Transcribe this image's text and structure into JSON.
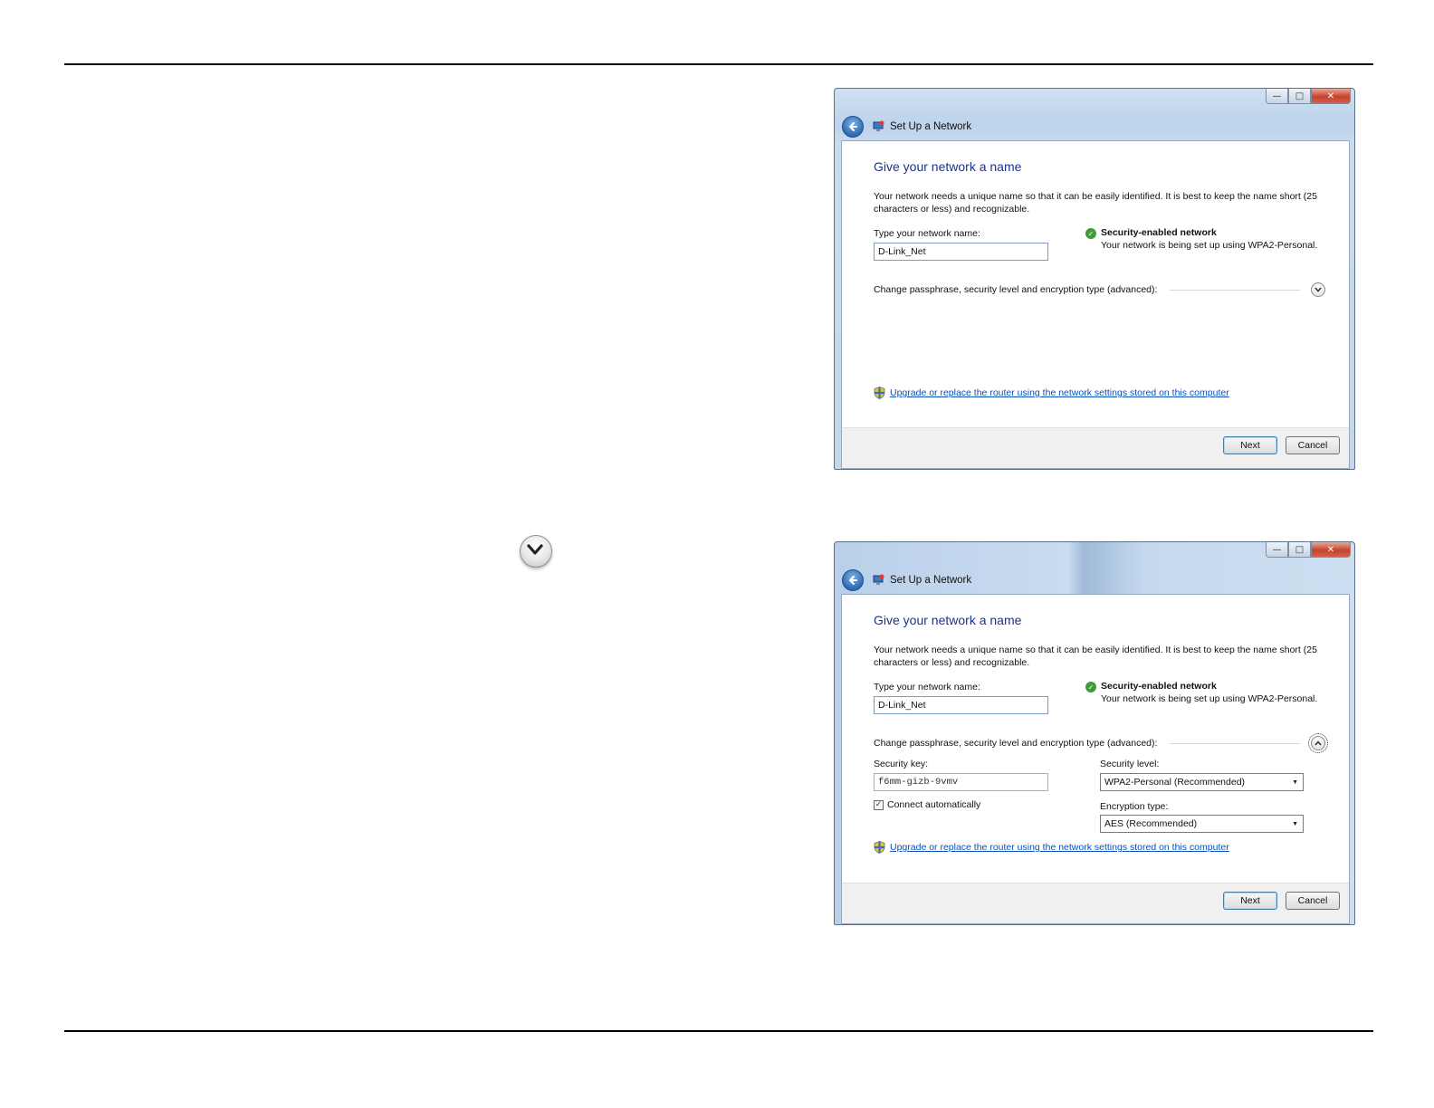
{
  "window1": {
    "title": "Set Up a Network",
    "heading": "Give your network a name",
    "description": "Your network needs a unique name so that it can be easily identified. It is best to keep the name short (25 characters or less) and recognizable.",
    "name_label": "Type your network name:",
    "name_value": "D-Link_Net",
    "security_title": "Security-enabled network",
    "security_desc": "Your network is being set up using WPA2-Personal.",
    "advanced_label": "Change passphrase, security level and encryption type (advanced):",
    "upgrade_link": "Upgrade or replace the router using the network settings stored on this computer",
    "next_label": "Next",
    "cancel_label": "Cancel"
  },
  "window2": {
    "title": "Set Up a Network",
    "heading": "Give your network a name",
    "description": "Your network needs a unique name so that it can be easily identified. It is best to keep the name short (25 characters or less) and recognizable.",
    "name_label": "Type your network name:",
    "name_value": "D-Link_Net",
    "security_title": "Security-enabled network",
    "security_desc": "Your network is being set up using WPA2-Personal.",
    "advanced_label": "Change passphrase, security level and encryption type (advanced):",
    "security_key_label": "Security key:",
    "security_key_value": "f6mm-gizb-9vmv",
    "security_level_label": "Security level:",
    "security_level_value": "WPA2-Personal (Recommended)",
    "encryption_label": "Encryption type:",
    "encryption_value": "AES (Recommended)",
    "connect_auto_label": "Connect automatically",
    "connect_auto_checked": true,
    "upgrade_link": "Upgrade or replace the router using the network settings stored on this computer",
    "next_label": "Next",
    "cancel_label": "Cancel"
  },
  "icons": {
    "expand": "chevron-down-circle-icon",
    "collapse": "chevron-up-circle-icon",
    "security": "green-shield-check-icon",
    "uac": "uac-shield-icon",
    "back": "back-arrow-icon",
    "network": "network-wizard-icon"
  },
  "colors": {
    "heading": "#1e3287",
    "link": "#0b4fb8",
    "security_green": "#3f9a3a"
  }
}
